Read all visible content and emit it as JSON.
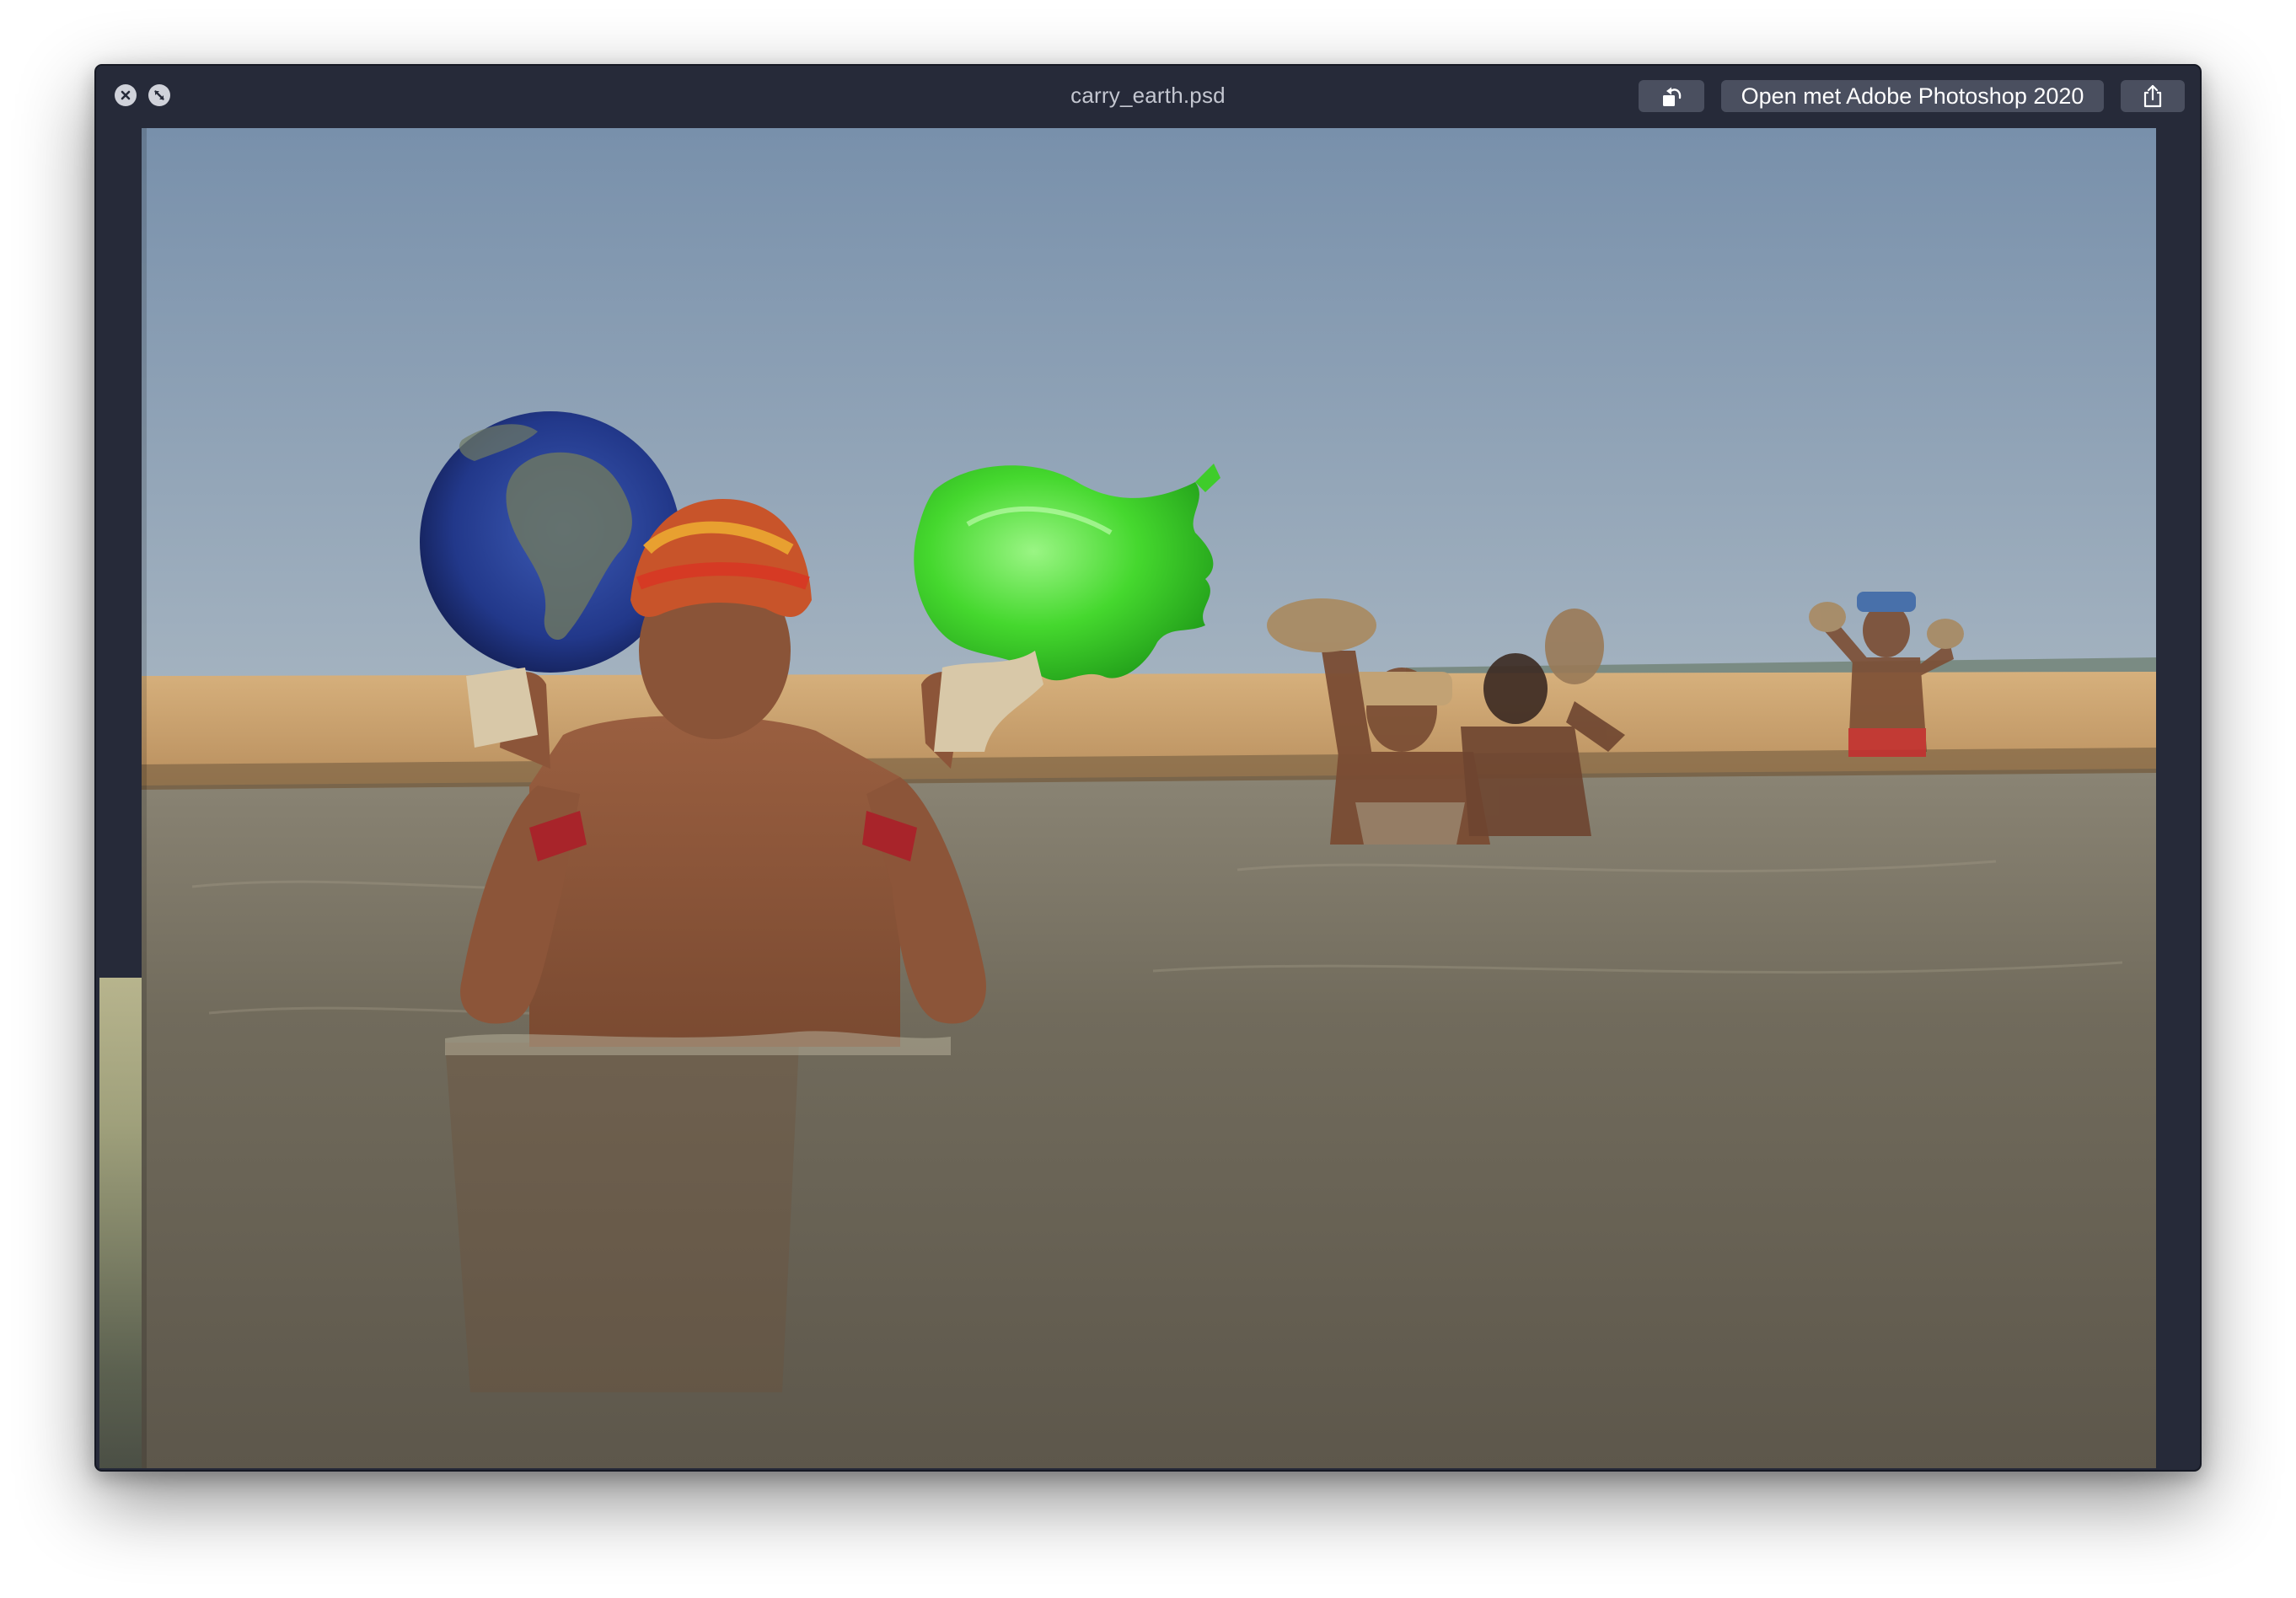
{
  "window": {
    "title": "carry_earth.psd"
  },
  "toolbar": {
    "close_icon": "close-icon",
    "fullscreen_icon": "fullscreen-icon",
    "rotate_icon": "rotate-left-icon",
    "open_with_label": "Open met Adobe Photoshop 2020",
    "share_icon": "share-icon"
  },
  "colors": {
    "window_bg": "#262a39",
    "button_bg": "#4a4f5f",
    "title_text": "#c3c6d0",
    "sky": "#8aa0b8",
    "sand": "#cfa874",
    "water": "#6f6a5c",
    "earth_blue": "#243a8c",
    "green_blob": "#3ccc28"
  }
}
